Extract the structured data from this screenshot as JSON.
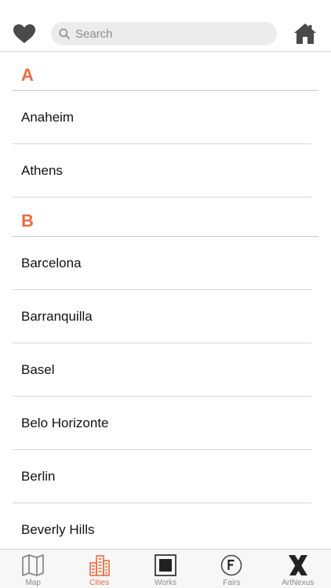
{
  "header": {
    "search": {
      "placeholder": "Search",
      "value": ""
    }
  },
  "sections": [
    {
      "letter": "A",
      "cities": [
        "Anaheim",
        "Athens"
      ]
    },
    {
      "letter": "B",
      "cities": [
        "Barcelona",
        "Barranquilla",
        "Basel",
        "Belo Horizonte",
        "Berlin",
        "Beverly Hills"
      ]
    }
  ],
  "tabbar": {
    "active": "cities",
    "items": [
      {
        "id": "map",
        "label": "Map",
        "icon": "map-icon"
      },
      {
        "id": "cities",
        "label": "Cities",
        "icon": "buildings-icon"
      },
      {
        "id": "works",
        "label": "Works",
        "icon": "square-frame-icon"
      },
      {
        "id": "fairs",
        "label": "Fairs",
        "icon": "f-circle-icon"
      },
      {
        "id": "artnexus",
        "label": "ArtNexus",
        "icon": "x-logo-icon"
      }
    ]
  },
  "colors": {
    "accent": "#ef6a3c",
    "icon_gray": "#4a4a4a",
    "tab_inactive": "#8a8a8a"
  }
}
